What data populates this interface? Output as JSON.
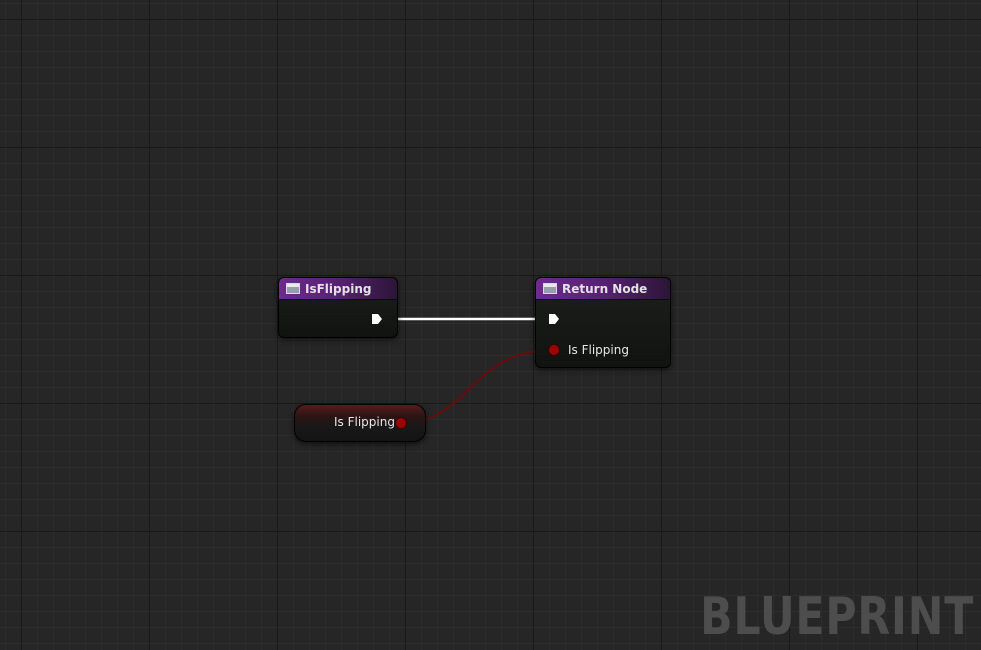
{
  "graph": {
    "watermark": "BLUEPRINT"
  },
  "nodes": {
    "entry": {
      "title": "IsFlipping",
      "icon": "function-icon"
    },
    "return": {
      "title": "Return Node",
      "icon": "function-icon",
      "input_label": "Is Flipping"
    },
    "getter": {
      "label": "Is Flipping"
    }
  },
  "colors": {
    "header_purple": "#6e2a8d",
    "exec_wire": "#ffffff",
    "bool_pin": "#9a0505",
    "bool_wire": "#6a0c0c",
    "graph_bg": "#262626"
  }
}
